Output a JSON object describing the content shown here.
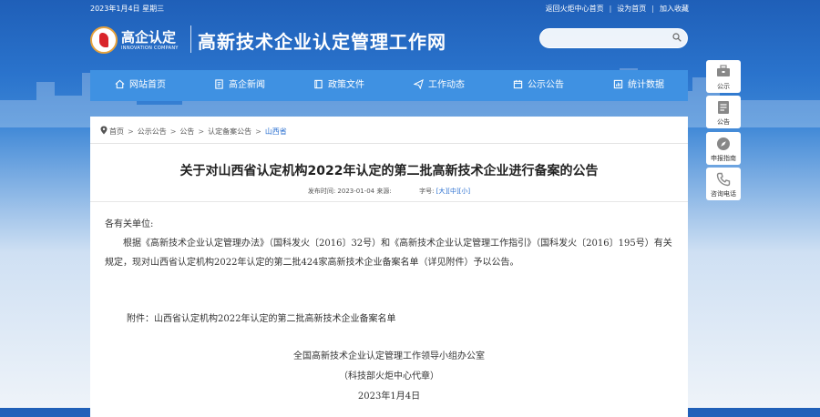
{
  "topbar": {
    "date": "2023年1月4日 星期三",
    "links": [
      "返回火炬中心首页",
      "设为首页",
      "加入收藏"
    ]
  },
  "header": {
    "logo_text": "高企认定",
    "logo_sub": "INNOVATION COMPANY",
    "site_title": "高新技术企业认定管理工作网",
    "search_value": ""
  },
  "nav": [
    {
      "label": "网站首页",
      "icon": "home-icon"
    },
    {
      "label": "高企新闻",
      "icon": "news-icon"
    },
    {
      "label": "政策文件",
      "icon": "book-icon"
    },
    {
      "label": "工作动态",
      "icon": "send-icon"
    },
    {
      "label": "公示公告",
      "icon": "calendar-icon"
    },
    {
      "label": "统计数据",
      "icon": "chart-icon"
    }
  ],
  "breadcrumb": [
    "首页",
    "公示公告",
    "公告",
    "认定备案公告",
    "山西省"
  ],
  "article": {
    "title": "关于对山西省认定机构2022年认定的第二批高新技术企业进行备案的公告",
    "meta_date_label": "发布时间:",
    "meta_date": "2023-01-04",
    "meta_source_label": "来源:",
    "meta_size_label": "字号:",
    "size_large": "[大]",
    "size_medium": "[中]",
    "size_small": "[小]",
    "salutation": "各有关单位:",
    "paragraph": "根据《高新技术企业认定管理办法》（国科发火〔2016〕32号）和《高新技术企业认定管理工作指引》（国科发火〔2016〕195号）有关规定，现对山西省认定机构2022年认定的第二批424家高新技术企业备案名单（详见附件）予以公告。",
    "attachment": "附件：山西省认定机构2022年认定的第二批高新技术企业备案名单",
    "signature": "全国高新技术企业认定管理工作领导小组办公室",
    "signature_sub": "（科技部火炬中心代章）",
    "sign_date": "2023年1月4日"
  },
  "side_buttons": [
    {
      "label": "公示",
      "icon": "briefcase-icon"
    },
    {
      "label": "公告",
      "icon": "notice-icon"
    },
    {
      "label": "申报指南",
      "icon": "compass-icon"
    },
    {
      "label": "咨询电话",
      "icon": "phone-icon"
    }
  ]
}
